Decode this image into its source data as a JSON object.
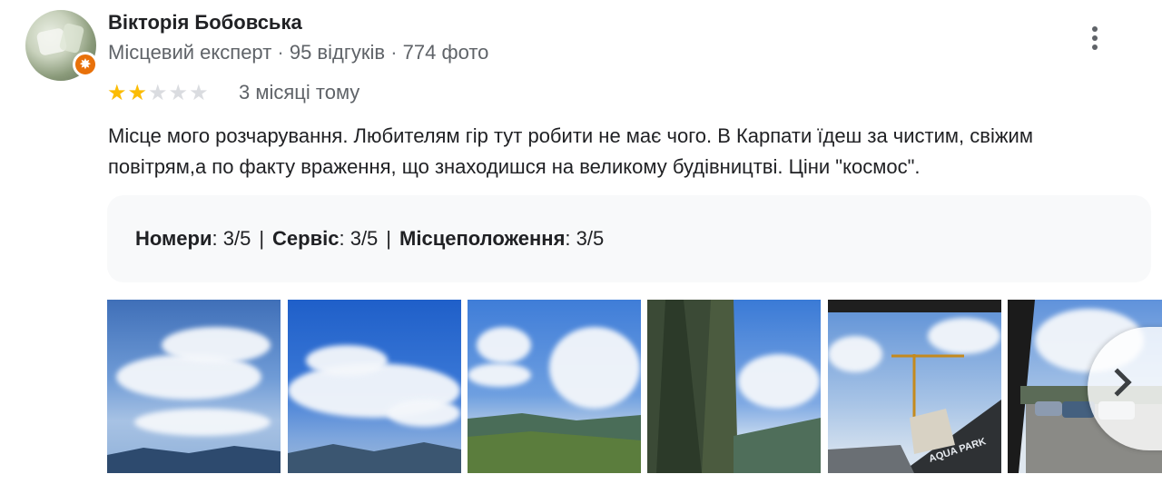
{
  "reviewer": {
    "name": "Вікторія Бобовська",
    "meta_role": "Місцевий експерт",
    "meta_sep": "·",
    "meta_reviews": "95 відгуків",
    "meta_photos": "774 фото"
  },
  "review": {
    "rating": 2,
    "rating_max": 5,
    "date": "3 місяці тому",
    "text": "Місце мого розчарування. Любителям  гір тут робити не має чого. В Карпати їдеш за чистим, свіжим повітрям,а по факту враження, що знаходишся на великому будівництві. Ціни \"космос\"."
  },
  "ratings": [
    {
      "label": "Номери",
      "value": ": 3/5"
    },
    {
      "label": "Сервіс",
      "value": ": 3/5"
    },
    {
      "label": "Місцеположення",
      "value": ": 3/5"
    }
  ],
  "ratings_sep": "|",
  "photos": {
    "count": 6,
    "overlay_text": "AQUA PARK"
  },
  "icons": {
    "more": "more-vert-icon",
    "next": "chevron-right-icon",
    "badge": "local-guide-star-icon",
    "star": "star-icon"
  },
  "colors": {
    "star_on": "#fbbc04",
    "star_off": "#dadce0",
    "badge": "#e8710a",
    "ratings_bg": "#f8f9fa"
  }
}
